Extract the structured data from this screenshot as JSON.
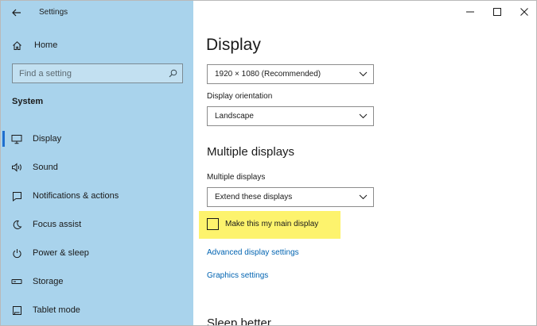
{
  "window": {
    "app_title": "Settings",
    "back_icon": "back-arrow-icon",
    "controls": [
      "minimize-icon",
      "maximize-icon",
      "close-icon"
    ]
  },
  "sidebar": {
    "home_label": "Home",
    "search_placeholder": "Find a setting",
    "section_label": "System",
    "items": [
      {
        "label": "Display",
        "icon": "monitor-icon",
        "active": true
      },
      {
        "label": "Sound",
        "icon": "speaker-icon"
      },
      {
        "label": "Notifications & actions",
        "icon": "notifications-icon"
      },
      {
        "label": "Focus assist",
        "icon": "moon-icon"
      },
      {
        "label": "Power & sleep",
        "icon": "power-icon"
      },
      {
        "label": "Storage",
        "icon": "storage-icon"
      },
      {
        "label": "Tablet mode",
        "icon": "tablet-icon"
      }
    ]
  },
  "main": {
    "title": "Display",
    "resolution_value": "1920 × 1080 (Recommended)",
    "orientation_label": "Display orientation",
    "orientation_value": "Landscape",
    "multiple_heading": "Multiple displays",
    "multiple_label": "Multiple displays",
    "multiple_value": "Extend these displays",
    "main_display_checkbox": "Make this my main display",
    "main_display_checked": false,
    "advanced_link": "Advanced display settings",
    "graphics_link": "Graphics settings",
    "next_heading": "Sleep better"
  },
  "colors": {
    "sidebar_bg": "#a9d3ec",
    "accent": "#1f6fcf",
    "link": "#0063b1",
    "highlight": "#fdf36d"
  }
}
